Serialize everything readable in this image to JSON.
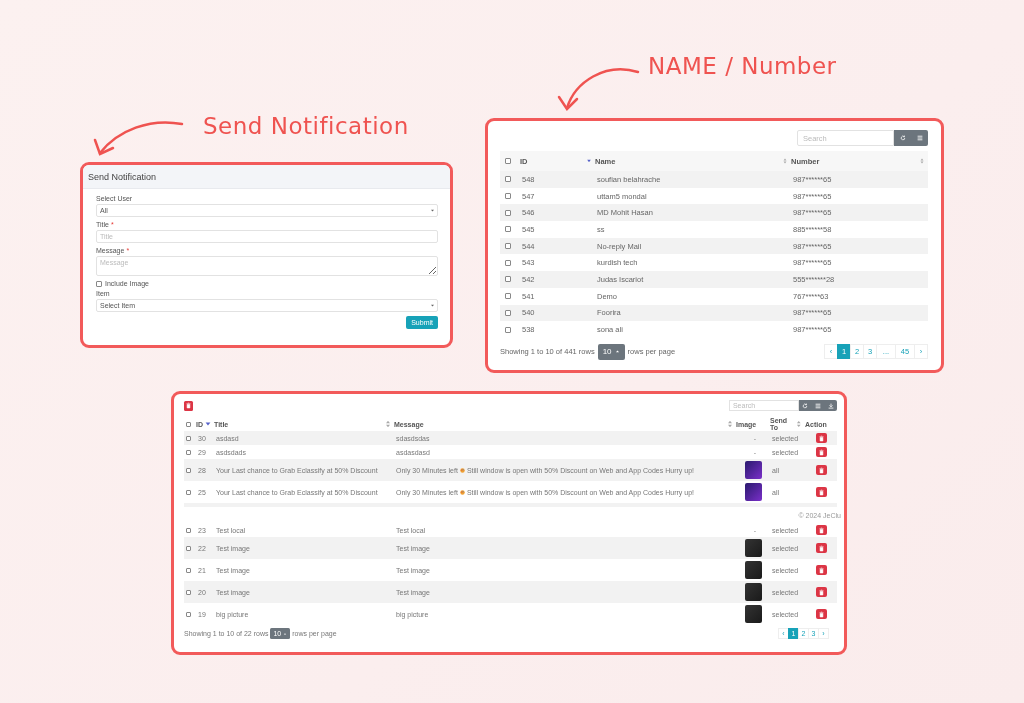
{
  "annotations": [
    {
      "text": "Send Notification"
    },
    {
      "text": "NAME / Number"
    }
  ],
  "notification_form": {
    "title": "Send Notification",
    "fields": [
      {
        "kind": "select",
        "label": "Select User",
        "value": "All"
      },
      {
        "kind": "input",
        "label": "Title",
        "required_mark": "*",
        "placeholder": "Title"
      },
      {
        "kind": "textarea",
        "label": "Message",
        "required_mark": "*",
        "placeholder": "Message"
      },
      {
        "kind": "checkbox",
        "label": "Include Image",
        "checked": false
      },
      {
        "kind": "select",
        "label": "Item",
        "value": "Select Item"
      }
    ],
    "submit": "Submit"
  },
  "users_table": {
    "search": {
      "placeholder": "Search"
    },
    "header_checked": false,
    "columns": [
      {
        "label": "ID",
        "sort_icon": true,
        "sorted": true
      },
      {
        "label": "Name",
        "sort_icon": true,
        "sorted": false
      },
      {
        "label": "Number",
        "sort_icon": true,
        "sorted": false
      }
    ],
    "rows": [
      {
        "id": "548",
        "name": "soufian belahrache",
        "number": "987******65",
        "checked": false
      },
      {
        "id": "547",
        "name": "uttam5 mondal",
        "number": "987******65",
        "checked": false
      },
      {
        "id": "546",
        "name": "MD Mohit Hasan",
        "number": "987******65",
        "checked": false
      },
      {
        "id": "545",
        "name": "ss",
        "number": "885******58",
        "checked": false
      },
      {
        "id": "544",
        "name": "No-reply Mail",
        "number": "987******65",
        "checked": false
      },
      {
        "id": "543",
        "name": "kurdish tech",
        "number": "987******65",
        "checked": false
      },
      {
        "id": "542",
        "name": "Judas Iscariot",
        "number": "555*******28",
        "checked": false
      },
      {
        "id": "541",
        "name": "Demo",
        "number": "767*****63",
        "checked": false
      },
      {
        "id": "540",
        "name": "Foorira",
        "number": "987******65",
        "checked": false
      },
      {
        "id": "538",
        "name": "sona ali",
        "number": "987******65",
        "checked": false
      }
    ],
    "summary": "Showing 1 to 10 of 441 rows",
    "page_size": "10",
    "page_size_label": "rows per page",
    "pages": [
      {
        "label": "‹",
        "selected": false
      },
      {
        "label": "1",
        "selected": true
      },
      {
        "label": "2",
        "selected": false
      },
      {
        "label": "3",
        "selected": false
      },
      {
        "label": "...",
        "selected": false
      },
      {
        "label": "45",
        "selected": false
      },
      {
        "label": "›",
        "selected": false
      }
    ]
  },
  "notifications_table": {
    "search": {
      "placeholder": "Search"
    },
    "header_checked": false,
    "columns": [
      {
        "label": "ID",
        "sort_icon": true,
        "sorted": true
      },
      {
        "label": "Title",
        "sort_icon": true,
        "sorted": false
      },
      {
        "label": "Message",
        "sort_icon": true,
        "sorted": false
      },
      {
        "label": "Image",
        "sort_icon": false
      },
      {
        "label": "Send To",
        "sort_icon": true,
        "sorted": false
      },
      {
        "label": "Action",
        "sort_icon": false
      }
    ],
    "rows_before_break": [
      {
        "id": "30",
        "title": "asdasd",
        "message": "sdasdsdas",
        "image": {
          "kind": "none",
          "text": "-"
        },
        "send_to": "selected",
        "checked": false
      },
      {
        "id": "29",
        "title": "asdsdads",
        "message": "asdasdasd",
        "image": {
          "kind": "none",
          "text": "-"
        },
        "send_to": "selected",
        "checked": false
      },
      {
        "id": "28",
        "title": "Your Last chance to Grab Eclassify at 50% Discount",
        "message": "Only 30 Minutes left",
        "message_tail": "Still window is open with 50% Discount on Web and App Codes Hurry up!",
        "image": {
          "kind": "promo"
        },
        "send_to": "all",
        "checked": false
      },
      {
        "id": "25",
        "title": "Your Last chance to Grab Eclassify at 50% Discount",
        "message": "Only 30 Minutes left",
        "message_tail": "Still window is open with 50% Discount on Web and App Codes Hurry up!",
        "image": {
          "kind": "promo"
        },
        "send_to": "all",
        "checked": false
      }
    ],
    "break_footer": "© 2024 JeClu",
    "rows_after_break": [
      {
        "id": "23",
        "title": "Test local",
        "message": "Test local",
        "image": {
          "kind": "none",
          "text": "-"
        },
        "send_to": "selected",
        "checked": false
      },
      {
        "id": "22",
        "title": "Test image",
        "message": "Test image",
        "image": {
          "kind": "logo"
        },
        "send_to": "selected",
        "checked": false
      },
      {
        "id": "21",
        "title": "Test image",
        "message": "Test image",
        "image": {
          "kind": "logo"
        },
        "send_to": "selected",
        "checked": false
      },
      {
        "id": "20",
        "title": "Test image",
        "message": "Test image",
        "image": {
          "kind": "logo"
        },
        "send_to": "selected",
        "checked": false
      },
      {
        "id": "19",
        "title": "big picture",
        "message": "big picture",
        "image": {
          "kind": "logo"
        },
        "send_to": "selected",
        "checked": false
      }
    ],
    "summary": "Showing 1 to 10 of 22 rows",
    "page_size": "10",
    "page_size_label": "rows per page",
    "pages": [
      {
        "label": "‹",
        "selected": false
      },
      {
        "label": "1",
        "selected": true
      },
      {
        "label": "2",
        "selected": false
      },
      {
        "label": "3",
        "selected": false
      },
      {
        "label": "›",
        "selected": false
      }
    ]
  }
}
